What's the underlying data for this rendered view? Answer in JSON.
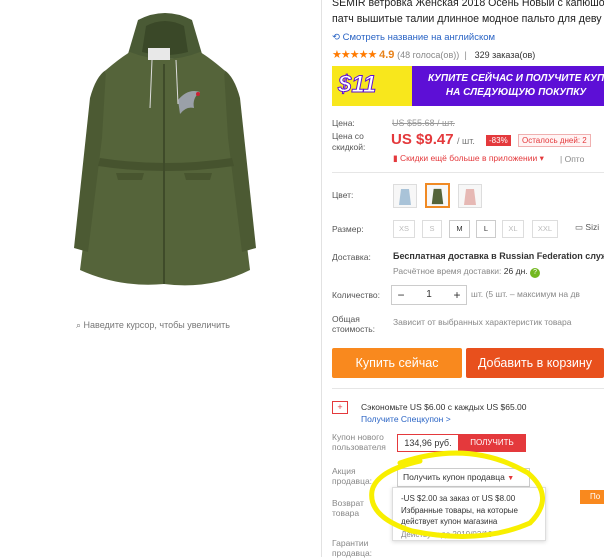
{
  "product": {
    "title_line1": "SEMIR ветровка Женская 2018 Осень Новый с капюшо",
    "title_line2": "патч вышитые талии длинное модное пальто для деву",
    "translate_link": "Смотреть название на английском",
    "stars": "★★★★★",
    "rating": "4.9",
    "votes": "(48 голоса(ов))",
    "orders": "329 заказа(ов)",
    "zoom_hint": "Наведите курсор, чтобы увеличить"
  },
  "banner": {
    "amount": "$11",
    "line1": "КУПИТЕ СЕЙЧАС И ПОЛУЧИТЕ КУП",
    "line2": "НА СЛЕДУЮЩУЮ ПОКУПКУ",
    "accent_color": "#5d0fd6",
    "yellow": "#f8e71c"
  },
  "price": {
    "label_price": "Цена:",
    "old_price": "US $55.68 / шт.",
    "label_discount_l1": "Цена со",
    "label_discount_l2": "скидкой:",
    "current": "US $9.47",
    "per_unit": "/ шт.",
    "discount_badge": "-83%",
    "days_left": "Осталось дней: 2",
    "app_discount": "Скидки ещё больше в приложении",
    "opt": "Опто"
  },
  "options": {
    "color_label": "Цвет:",
    "size_label": "Размер:",
    "sizes": [
      "XS",
      "S",
      "M",
      "L",
      "XL",
      "XXL"
    ],
    "size_chart": "Sizi"
  },
  "shipping": {
    "label": "Доставка:",
    "text": "Бесплатная доставка в Russian Federation служб",
    "time_label": "Расчётное время доставки:",
    "time_value": "26 дн."
  },
  "quantity": {
    "label": "Количество:",
    "minus": "−",
    "value": "1",
    "plus": "+",
    "note": "шт. (5 шт. – максимум на дв"
  },
  "total": {
    "label_l1": "Общая",
    "label_l2": "стоимость:",
    "text": "Зависит от выбранных характеристик товара"
  },
  "buttons": {
    "buy_now": "Купить сейчас",
    "add_to_cart": "Добавить в корзину"
  },
  "promo": {
    "save_text": "Сэкономьте US $6.00 с каждых US $65.00",
    "special_coupon": "Получите Спецкупон >",
    "new_user_l1": "Купон нового",
    "new_user_l2": "пользователя",
    "coupon_price": "134,96 руб.",
    "get_button": "ПОЛУЧИТЬ",
    "seller_action_l1": "Акция",
    "seller_action_l2": "продавца:",
    "seller_coupon_dropdown": "Получить купон продавца",
    "refund_l1": "Возврат",
    "refund_l2": "товара",
    "guarantee_l1": "Гарантии",
    "guarantee_l2": "продавца:",
    "popup_line1": "-US $2.00 за заказ от US $8.00",
    "popup_line2": "Избранные товары, на которые",
    "popup_line3": "действует купон магазина",
    "popup_line4": "Действует до 2019/03/19",
    "popup_side_btn": "По"
  }
}
